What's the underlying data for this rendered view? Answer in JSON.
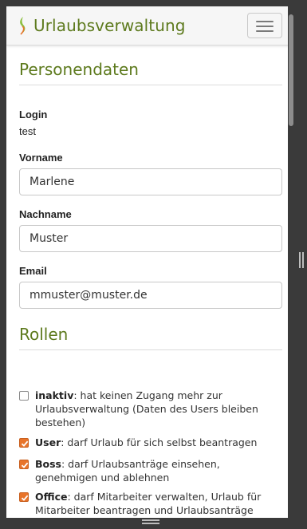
{
  "app": {
    "title": "Urlaubsverwaltung",
    "brand_color": "#5d7a1d",
    "accent_color": "#e8742a"
  },
  "navbar": {
    "menu_icon": "hamburger-menu-icon",
    "logo_icon": "leaf-logo-icon"
  },
  "personendaten": {
    "title": "Personendaten",
    "login_label": "Login",
    "login_value": "test",
    "vorname_label": "Vorname",
    "vorname_value": "Marlene",
    "nachname_label": "Nachname",
    "nachname_value": "Muster",
    "email_label": "Email",
    "email_value": "mmuster@muster.de"
  },
  "rollen": {
    "title": "Rollen",
    "items": [
      {
        "name": "inaktiv",
        "description": ": hat keinen Zugang mehr zur Urlaubsverwaltung (Daten des Users bleiben bestehen)",
        "checked": false
      },
      {
        "name": "User",
        "description": ": darf Urlaub für sich selbst beantragen",
        "checked": true
      },
      {
        "name": "Boss",
        "description": ": darf Urlaubsanträge einsehen, genehmigen und ablehnen",
        "checked": true
      },
      {
        "name": "Office",
        "description": ": darf Mitarbeiter verwalten, Urlaub für Mitarbeiter beantragen und Urlaubsanträge stornieren",
        "checked": true
      }
    ]
  }
}
